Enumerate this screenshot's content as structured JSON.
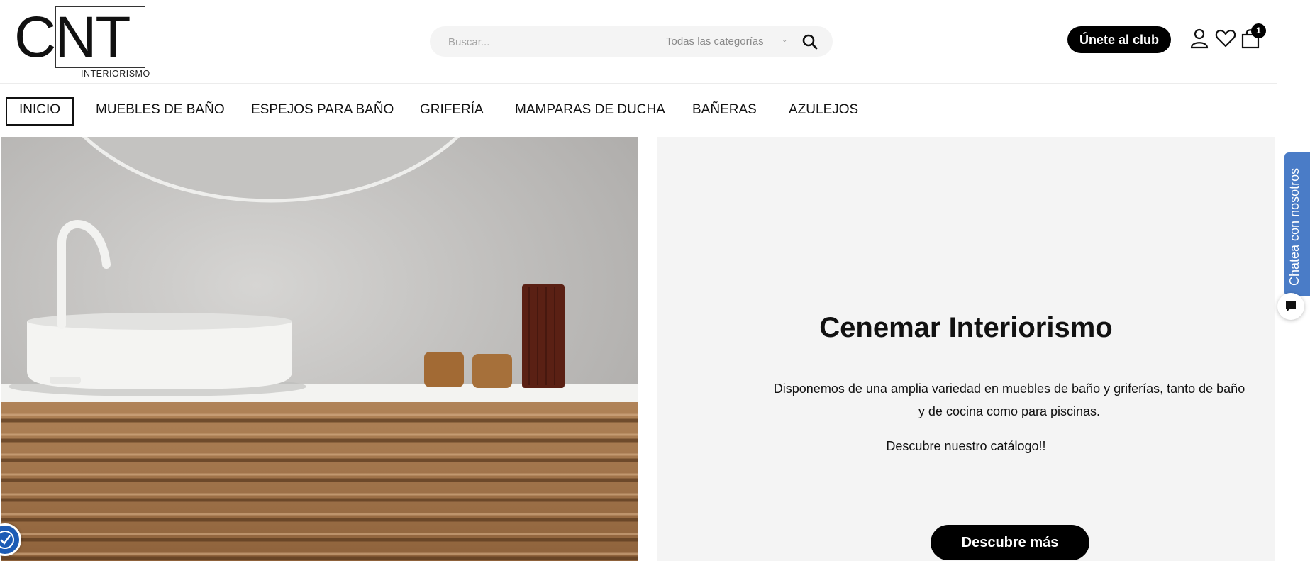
{
  "logo": {
    "letters": "CNT",
    "subtitle": "INTERIORISMO"
  },
  "search": {
    "placeholder": "Buscar...",
    "category": "Todas las categorías"
  },
  "header": {
    "club_label": "Únete al club",
    "cart_count": "1"
  },
  "nav": {
    "items": [
      {
        "label": "INICIO",
        "active": true
      },
      {
        "label": "MUEBLES DE BAÑO"
      },
      {
        "label": "ESPEJOS PARA BAÑO"
      },
      {
        "label": "GRIFERÍA"
      },
      {
        "label": "MAMPARAS DE DUCHA"
      },
      {
        "label": "BAÑERAS"
      },
      {
        "label": "AZULEJOS"
      }
    ]
  },
  "hero": {
    "title": "Cenemar Interiorismo",
    "description": "Disponemos de una amplia variedad en muebles de baño y griferías, tanto de baño y de cocina como para piscinas.",
    "cta_text": "Descubre nuestro catálogo!!",
    "button_label": "Descubre más"
  },
  "chat": {
    "label": "Chatea con nosotros"
  },
  "colors": {
    "accent": "#000000",
    "chat": "#4a7cc7",
    "panel": "#f4f4f4"
  }
}
